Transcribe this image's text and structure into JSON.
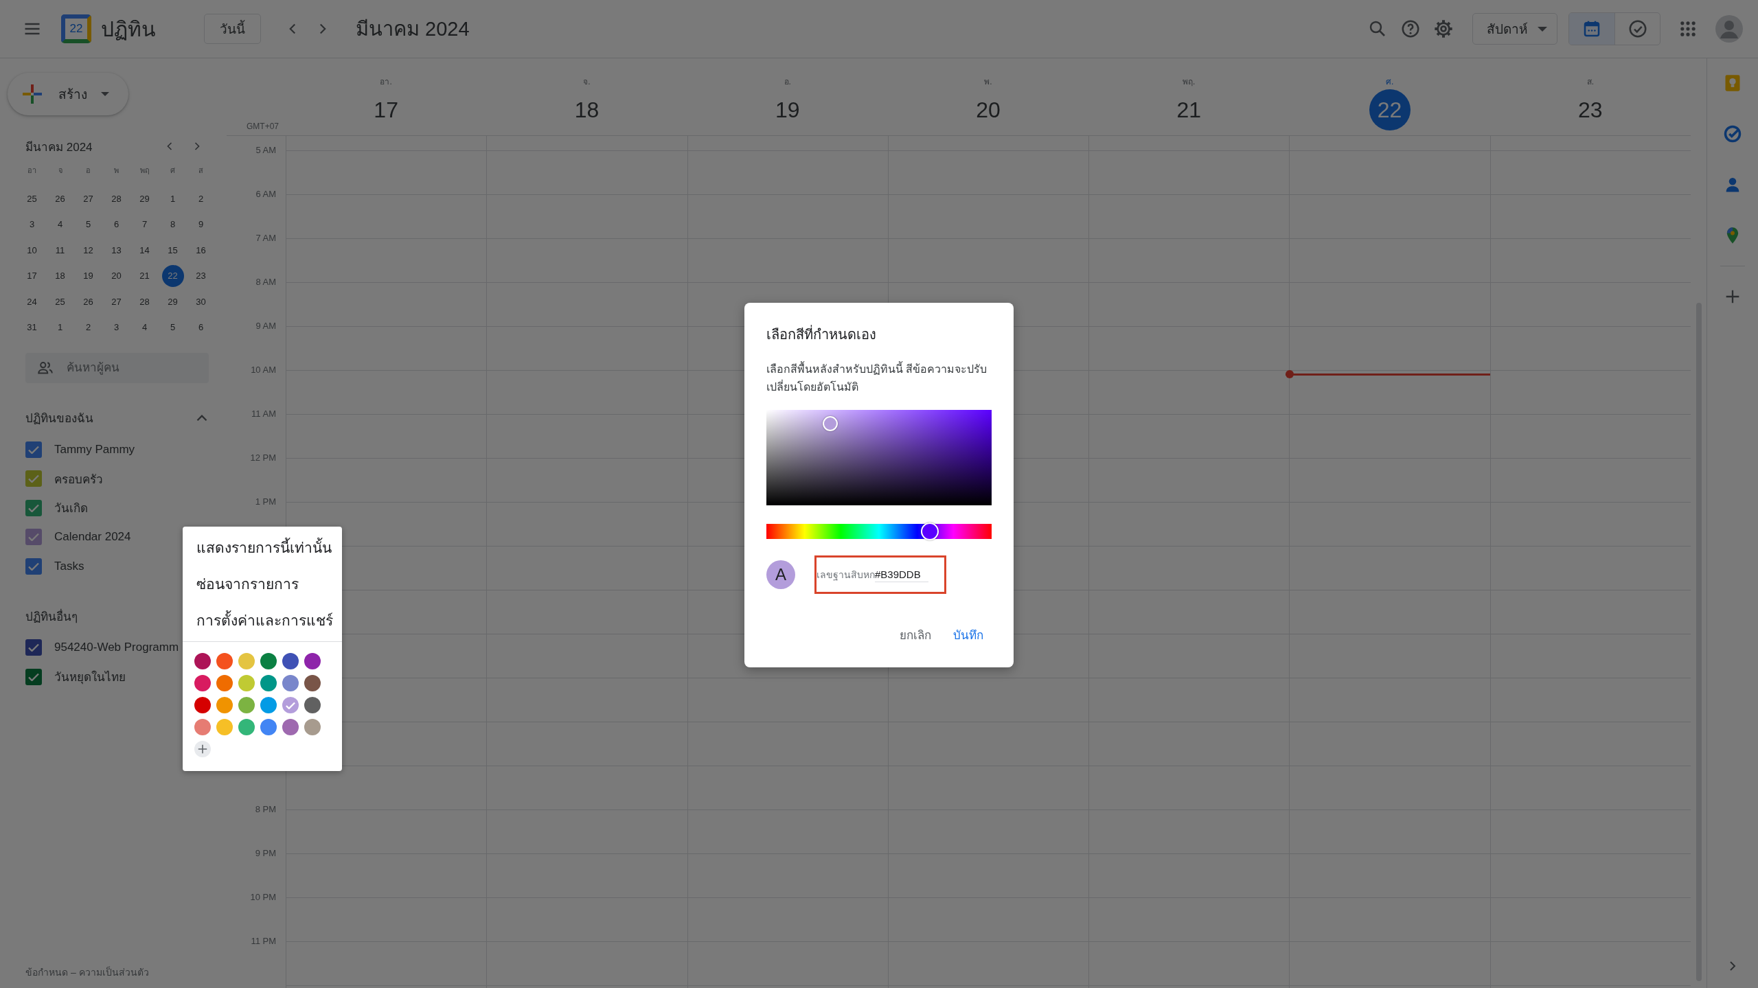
{
  "header": {
    "logo_text": "22",
    "app_title": "ปฏิทิน",
    "today_button": "วันนี้",
    "period": "มีนาคม 2024",
    "view_select": "สัปดาห์",
    "view_toggles": [
      {
        "kind": "calendar",
        "selected": true
      },
      {
        "kind": "tasks",
        "selected": false
      }
    ]
  },
  "create_button": "สร้าง",
  "mini_calendar": {
    "title": "มีนาคม 2024",
    "weekdays": [
      "อา",
      "จ",
      "อ",
      "พ",
      "พฤ",
      "ศ",
      "ส"
    ],
    "weeks": [
      [
        {
          "label": "25",
          "selected": false
        },
        {
          "label": "26",
          "selected": false
        },
        {
          "label": "27",
          "selected": false
        },
        {
          "label": "28",
          "selected": false
        },
        {
          "label": "29",
          "selected": false
        },
        {
          "label": "1",
          "selected": false
        },
        {
          "label": "2",
          "selected": false
        }
      ],
      [
        {
          "label": "3",
          "selected": false
        },
        {
          "label": "4",
          "selected": false
        },
        {
          "label": "5",
          "selected": false
        },
        {
          "label": "6",
          "selected": false
        },
        {
          "label": "7",
          "selected": false
        },
        {
          "label": "8",
          "selected": false
        },
        {
          "label": "9",
          "selected": false
        }
      ],
      [
        {
          "label": "10",
          "selected": false
        },
        {
          "label": "11",
          "selected": false
        },
        {
          "label": "12",
          "selected": false
        },
        {
          "label": "13",
          "selected": false
        },
        {
          "label": "14",
          "selected": false
        },
        {
          "label": "15",
          "selected": false
        },
        {
          "label": "16",
          "selected": false
        }
      ],
      [
        {
          "label": "17",
          "selected": false
        },
        {
          "label": "18",
          "selected": false
        },
        {
          "label": "19",
          "selected": false
        },
        {
          "label": "20",
          "selected": false
        },
        {
          "label": "21",
          "selected": false
        },
        {
          "label": "22",
          "selected": true
        },
        {
          "label": "23",
          "selected": false
        }
      ],
      [
        {
          "label": "24",
          "selected": false
        },
        {
          "label": "25",
          "selected": false
        },
        {
          "label": "26",
          "selected": false
        },
        {
          "label": "27",
          "selected": false
        },
        {
          "label": "28",
          "selected": false
        },
        {
          "label": "29",
          "selected": false
        },
        {
          "label": "30",
          "selected": false
        }
      ],
      [
        {
          "label": "31",
          "selected": false
        },
        {
          "label": "1",
          "selected": false
        },
        {
          "label": "2",
          "selected": false
        },
        {
          "label": "3",
          "selected": false
        },
        {
          "label": "4",
          "selected": false
        },
        {
          "label": "5",
          "selected": false
        },
        {
          "label": "6",
          "selected": false
        }
      ]
    ]
  },
  "people_search": {
    "placeholder": "ค้นหาผู้คน"
  },
  "my_calendars": {
    "title": "ปฏิทินของฉัน",
    "expanded": true,
    "items": [
      {
        "label": "Tammy Pammy",
        "checked": true,
        "color": "#204075"
      },
      {
        "label": "ครอบครัว",
        "checked": true,
        "color": "#5c6118"
      },
      {
        "label": "วันเกิด",
        "checked": true,
        "color": "#18573a"
      },
      {
        "label": "Calendar 2024",
        "checked": true,
        "color": "#564b69"
      },
      {
        "label": "Tasks",
        "checked": true,
        "color": "#204075"
      }
    ]
  },
  "other_calendars": {
    "title": "ปฏิทินอื่นๆ",
    "items": [
      {
        "label": "954240-Web Programm",
        "checked": true,
        "color": "#1e2757"
      },
      {
        "label": "วันหยุดในไทย",
        "checked": true,
        "color": "#053d20"
      }
    ]
  },
  "footer": "ข้อกำหนด – ความเป็นส่วนตัว",
  "week": {
    "timezone": "GMT+07",
    "days": [
      {
        "weekday": "อา.",
        "date": "17",
        "selected": false,
        "current_time": false
      },
      {
        "weekday": "จ.",
        "date": "18",
        "selected": false,
        "current_time": false
      },
      {
        "weekday": "อ.",
        "date": "19",
        "selected": false,
        "current_time": false
      },
      {
        "weekday": "พ.",
        "date": "20",
        "selected": false,
        "current_time": false
      },
      {
        "weekday": "พฤ.",
        "date": "21",
        "selected": false,
        "current_time": false
      },
      {
        "weekday": "ศ.",
        "date": "22",
        "selected": true,
        "current_time": true
      },
      {
        "weekday": "ส.",
        "date": "23",
        "selected": false,
        "current_time": false
      }
    ],
    "hours_top": [
      "5 AM",
      "6 AM",
      "7 AM",
      "8 AM",
      "9 AM",
      "10 AM",
      "11 AM",
      "12 PM",
      "1 PM"
    ],
    "hours_bottom": [
      "8 PM",
      "9 PM",
      "10 PM",
      "11 PM"
    ]
  },
  "context_menu": {
    "items": [
      "แสดงรายการนี้เท่านั้น",
      "ซ่อนจากรายการ",
      "การตั้งค่าและการแชร์"
    ],
    "colors": [
      {
        "color": "#ad1457",
        "selected": false
      },
      {
        "color": "#f4511e",
        "selected": false
      },
      {
        "color": "#e4c441",
        "selected": false
      },
      {
        "color": "#0b8043",
        "selected": false
      },
      {
        "color": "#3f51b5",
        "selected": false
      },
      {
        "color": "#8e24aa",
        "selected": false
      },
      {
        "color": "#d81b60",
        "selected": false
      },
      {
        "color": "#ef6c00",
        "selected": false
      },
      {
        "color": "#c0ca33",
        "selected": false
      },
      {
        "color": "#009688",
        "selected": false
      },
      {
        "color": "#7986cb",
        "selected": false
      },
      {
        "color": "#795548",
        "selected": false
      },
      {
        "color": "#d50000",
        "selected": false
      },
      {
        "color": "#f09300",
        "selected": false
      },
      {
        "color": "#7cb342",
        "selected": false
      },
      {
        "color": "#039be5",
        "selected": false
      },
      {
        "color": "#b39ddb",
        "selected": true
      },
      {
        "color": "#616161",
        "selected": false
      },
      {
        "color": "#e67c73",
        "selected": false
      },
      {
        "color": "#f6bf26",
        "selected": false
      },
      {
        "color": "#33b679",
        "selected": false
      },
      {
        "color": "#4285f4",
        "selected": false
      },
      {
        "color": "#9e69af",
        "selected": false
      },
      {
        "color": "#a79b8e",
        "selected": false
      }
    ]
  },
  "dialog": {
    "title": "เลือกสีที่กำหนดเอง",
    "description": "เลือกสีพื้นหลังสำหรับปฏิทินนี้ สีข้อความจะปรับเปลี่ยนโดยอัตโนมัติ",
    "preview_letter": "A",
    "hex_label": "เลขฐานสิบหก",
    "hex_value": "#B39DDB",
    "cancel_button": "ยกเลิก",
    "save_button": "บันทึก"
  }
}
